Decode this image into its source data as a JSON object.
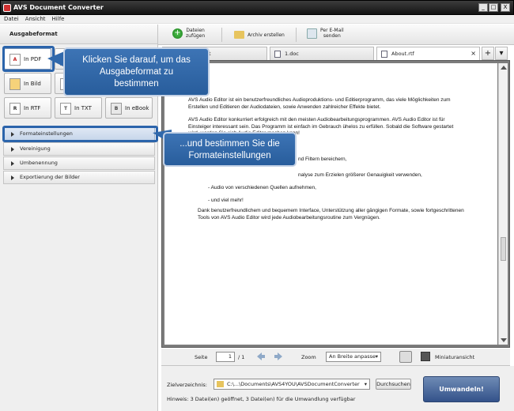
{
  "window": {
    "title": "AVS Document Converter",
    "controls": [
      "_",
      "□",
      "X"
    ]
  },
  "menu": [
    "Datei",
    "Ansicht",
    "Hilfe"
  ],
  "left": {
    "header": "Ausgabeformat",
    "formats": [
      "In PDF",
      "In Bild",
      "In RTF",
      "In TXT",
      "In eBook"
    ],
    "sections": [
      "Formateinstellungen",
      "Vereinigung",
      "Umbenennung",
      "Exportierung der Bilder"
    ]
  },
  "toolbar": {
    "add_l1": "Dateien",
    "add_l2": "zufügen",
    "archive": "Archiv erstellen",
    "email_l1": "Per E-Mail",
    "email_l2": "senden"
  },
  "tabs": [
    "t",
    "1.doc",
    "About.rtf"
  ],
  "document": [
    "AVS Audio Editor ist ein benutzerfreundliches Audioproduktions- und Editierprogramm, das viele Möglichkeiten zum Erstellen und Editieren der Audiodateien, sowie Anwenden zahlreicher Effekte bietet.",
    "AVS Audio Editor konkurriert erfolgreich mit den meisten Audiobearbeitungsprogrammen. AVS Audio Editor ist für Einsteiger interessant sein. Das Programm ist einfach im Gebrauch ühelos zu erfüllen.  Sobald die Software gestartet wird, werden Sie sich Audio Editor machen kann!",
    "nd Filtern bereichern,",
    "nalyse zum Erzielen größerer Genauigkeit verwenden,",
    "- Audio von verschiedenen Quellen aufnehmen,",
    "- und viel mehr!",
    "Dank benutzerfreundlichem und bequemem Interface, Unterstützung aller gängigen Formate, sowie fortgeschrittenen Tools von AVS Audio Editor wird jede Audiobearbeitungsroutine zum Vergnügen."
  ],
  "pager": {
    "page_label": "Seite",
    "page_value": "1",
    "page_total": "/ 1",
    "zoom_label": "Zoom",
    "zoom_value": "An Breite anpasse",
    "thumbs": "Miniaturansicht"
  },
  "bottom": {
    "target_label": "Zielverzeichnis:",
    "target_path": "C:\\...\\Documents\\AVS4YOU\\AVSDocumentConverter",
    "browse": "Durchsuchen",
    "hint": "Hinweis: 3 Datei(en) geöffnet, 3 Datei(en) für die Umwandlung verfügbar",
    "convert": "Umwandeln!"
  },
  "callouts": {
    "one": [
      "Klicken Sie darauf, um das",
      "Ausgabeformat zu",
      "bestimmen"
    ],
    "two": [
      "...und bestimmen Sie die",
      "Formateinstellungen"
    ]
  },
  "colors": {
    "callout": "#2f66a8",
    "convert": "#3e5f95"
  }
}
